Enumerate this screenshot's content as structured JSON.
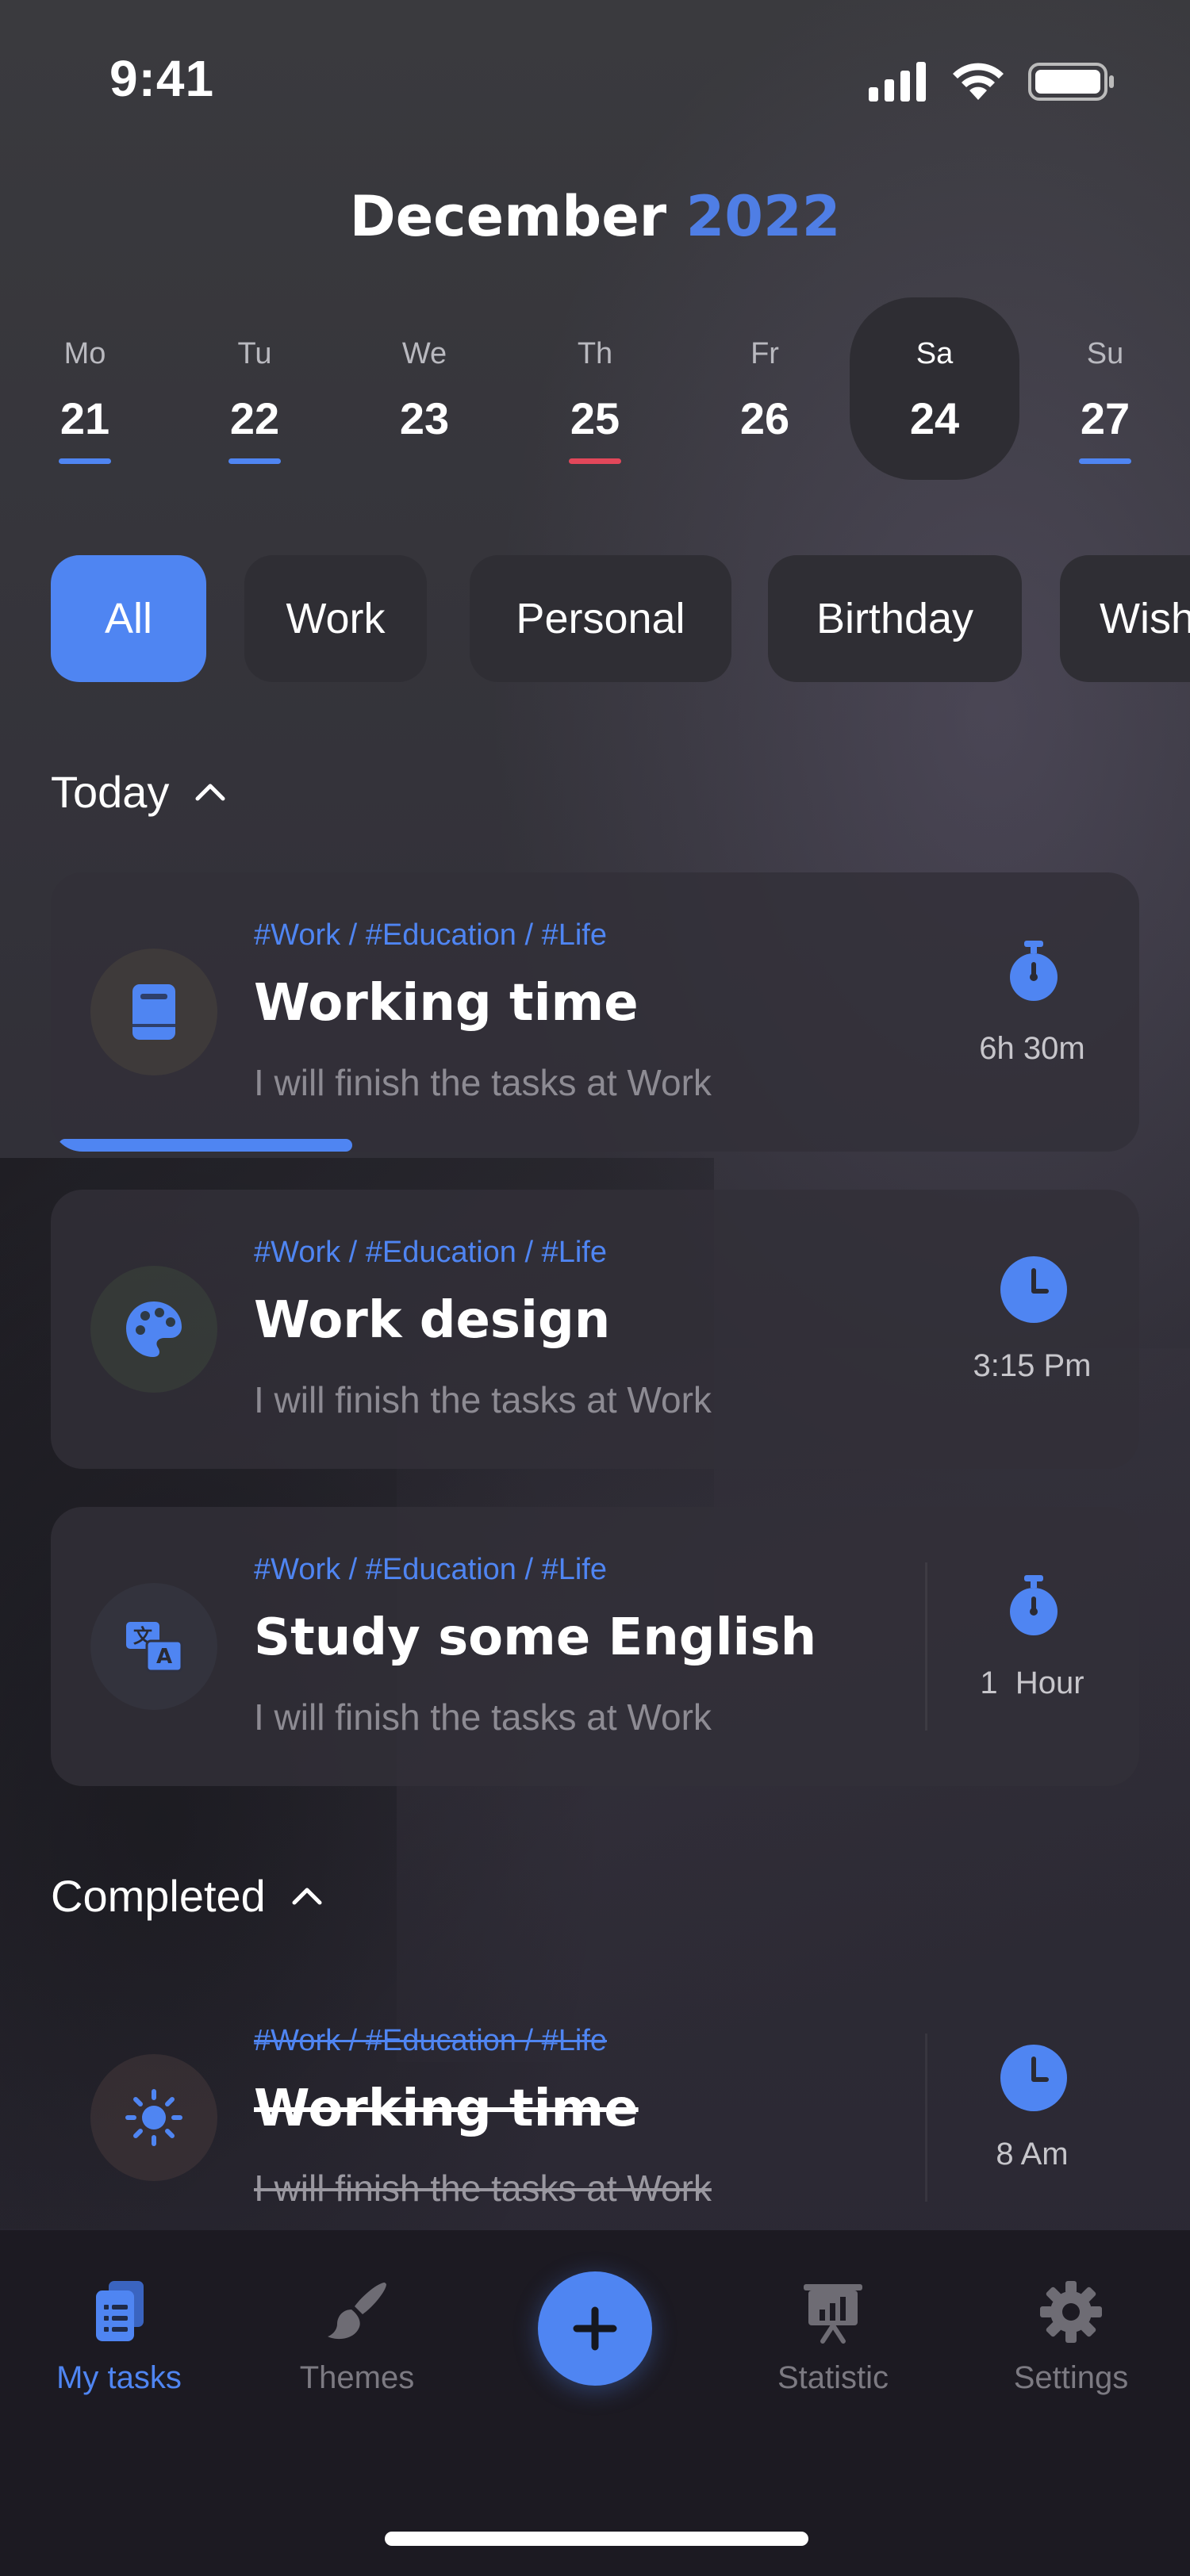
{
  "status_bar": {
    "time": "9:41"
  },
  "header": {
    "month": "December",
    "year": "2022"
  },
  "week": [
    {
      "name": "Mo",
      "num": "21",
      "mark": "#4f85f2"
    },
    {
      "name": "Tu",
      "num": "22",
      "mark": "#4f85f2"
    },
    {
      "name": "We",
      "num": "23",
      "mark": ""
    },
    {
      "name": "Th",
      "num": "25",
      "mark": "#e2475a"
    },
    {
      "name": "Fr",
      "num": "26",
      "mark": ""
    },
    {
      "name": "Sa",
      "num": "24",
      "mark": "",
      "selected": true
    },
    {
      "name": "Su",
      "num": "27",
      "mark": "#4f85f2"
    }
  ],
  "filters": [
    "All",
    "Work",
    "Personal",
    "Birthday",
    "Wishlist"
  ],
  "active_filter": "All",
  "sections": {
    "today": "Today",
    "completed": "Completed"
  },
  "tasks": [
    {
      "tags": "#Work / #Education / #Life",
      "title": "Working time",
      "desc": "I will finish the tasks at Work",
      "meta": "6h 30m",
      "icon": "book-icon",
      "meta_icon": "stopwatch-icon",
      "progress": 0.27
    },
    {
      "tags": "#Work / #Education / #Life",
      "title": "Work design",
      "desc": "I will finish the tasks at Work",
      "meta": "3:15 Pm",
      "icon": "palette-icon",
      "meta_icon": "clock-icon"
    },
    {
      "tags": "#Work / #Education / #Life",
      "title": "Study some English",
      "desc": "I will finish the tasks at Work",
      "meta": "1  Hour",
      "icon": "translate-icon",
      "meta_icon": "stopwatch-icon"
    }
  ],
  "completed_tasks": [
    {
      "tags": "#Work / #Education / #Life",
      "title": "Working time",
      "desc": "I will finish the tasks at Work",
      "meta": "8 Am",
      "icon": "sun-icon",
      "meta_icon": "clock-icon"
    }
  ],
  "nav": {
    "my_tasks": "My tasks",
    "themes": "Themes",
    "statistic": "Statistic",
    "settings": "Settings"
  },
  "colors": {
    "accent": "#4f85f2",
    "today_mark": "#e2475a",
    "background": "#2b2a30"
  }
}
